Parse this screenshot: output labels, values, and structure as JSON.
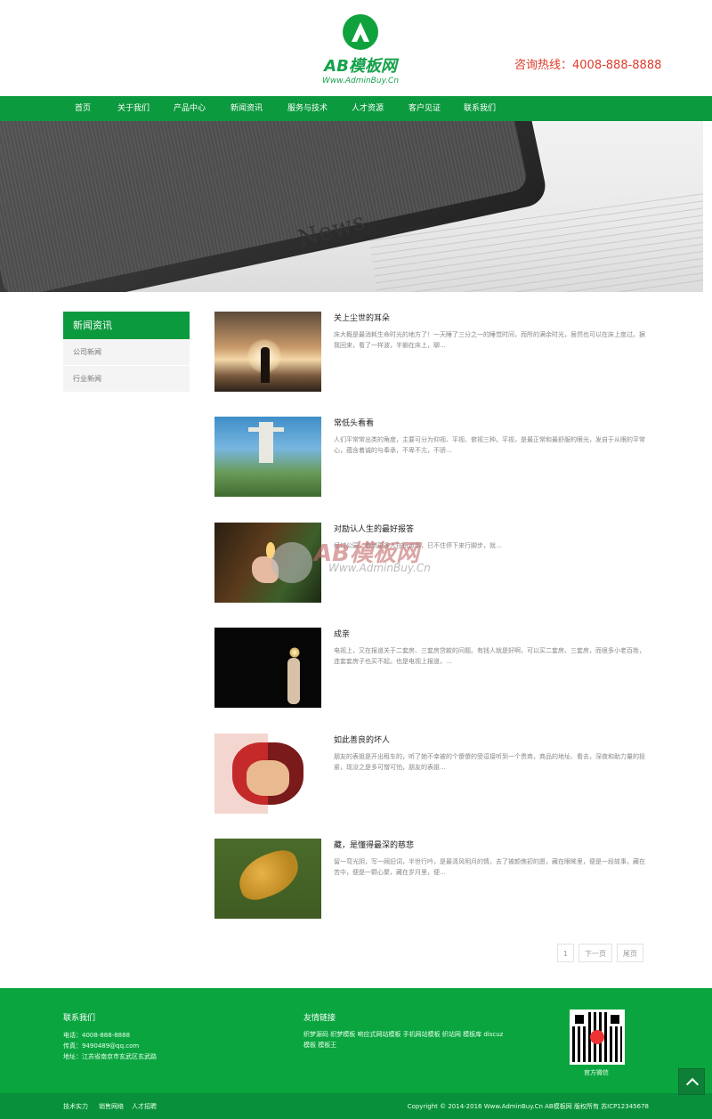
{
  "header": {
    "logo_text": "AB模板网",
    "logo_url": "Www.AdminBuy.Cn",
    "hotline": "咨询热线：4008-888-8888"
  },
  "nav": {
    "items": [
      {
        "label": "首页"
      },
      {
        "label": "关于我们"
      },
      {
        "label": "产品中心"
      },
      {
        "label": "新闻资讯"
      },
      {
        "label": "服务与技术"
      },
      {
        "label": "人才资源"
      },
      {
        "label": "客户见证"
      },
      {
        "label": "联系我们"
      }
    ]
  },
  "banner": {
    "text": "News"
  },
  "sidebar": {
    "title": "新闻资讯",
    "items": [
      {
        "label": "公司新闻"
      },
      {
        "label": "行业新闻"
      }
    ]
  },
  "news": [
    {
      "title": "关上尘世的耳朵",
      "desc": "床大概是最消耗生命时光的地方了！一天睡了三分之一的睡觉时间，而所的满余时光，居然也可以在床上度过。据我回来，看了一样波，半躺在床上，聊...",
      "icon": "sunset-silhouette-image"
    },
    {
      "title": "常低头看看",
      "desc": "人们平常常出类的角度，主要可分为仰视、平视、俯视三种。平视，是最正常和最舒服的眼光，发自于从眼的平常心，蕴含着诚的与奉承，不卑不亢，不骄...",
      "icon": "statue-landscape-image"
    },
    {
      "title": "对励认人生的最好报答",
      "desc": "经过公园，看到更多人在玩风筝，巳不住停下来行脚步，就...",
      "icon": "hand-candle-image"
    },
    {
      "title": "成亲",
      "desc": "电视上，又在报道关于二套房、三套房贷款的问题。有钱人就是好啊，可以买二套房、三套房，而很多小老百姓，连套套房子也买不起。也是电视上报道，...",
      "icon": "lightbulb-hand-image"
    },
    {
      "title": "如此善良的坏人",
      "desc": "朋友的表姐是开出租车的，听了她不幸被的个傻傻的受逗接听到一个贵商，商品的地址、看去，深夜和助力量的投紧，现没之是多可憎可怕，朋友的表姐...",
      "icon": "cartoon-face-image"
    },
    {
      "title": "藏，是懂得最深的慈悲",
      "desc": "留一弯光阴，写一阙旧词，半世行吟，是最清风明月的情，去了被颜憔初的愿，藏在眼眸里，便是一段故事，藏在苦中，便是一颗心聚，藏在岁月里，便...",
      "icon": "autumn-leaf-image"
    }
  ],
  "pagination": {
    "current": "1",
    "next": "下一页",
    "last": "尾页"
  },
  "watermark": {
    "text": "AB模板网",
    "url": "Www.AdminBuy.Cn"
  },
  "footer": {
    "contact_title": "联系我们",
    "phone": "电话：4008-888-8888",
    "fax": "传真：9490489@qq.com",
    "address": "地址：江苏省南京市玄武区玄武路",
    "links_title": "友情链接",
    "links_text": "织梦源码 织梦模板 响应式网站模板 手机网站模板 织站网 模板库 discuz模板 模板王",
    "qr_label": "官方微信"
  },
  "bottom": {
    "links": [
      {
        "label": "技术实力"
      },
      {
        "label": "销售网络"
      },
      {
        "label": "人才招聘"
      }
    ],
    "copyright": "Copyright © 2014-2016 Www.AdminBuy.Cn AB模板网 版权所有   苏ICP12345678"
  }
}
